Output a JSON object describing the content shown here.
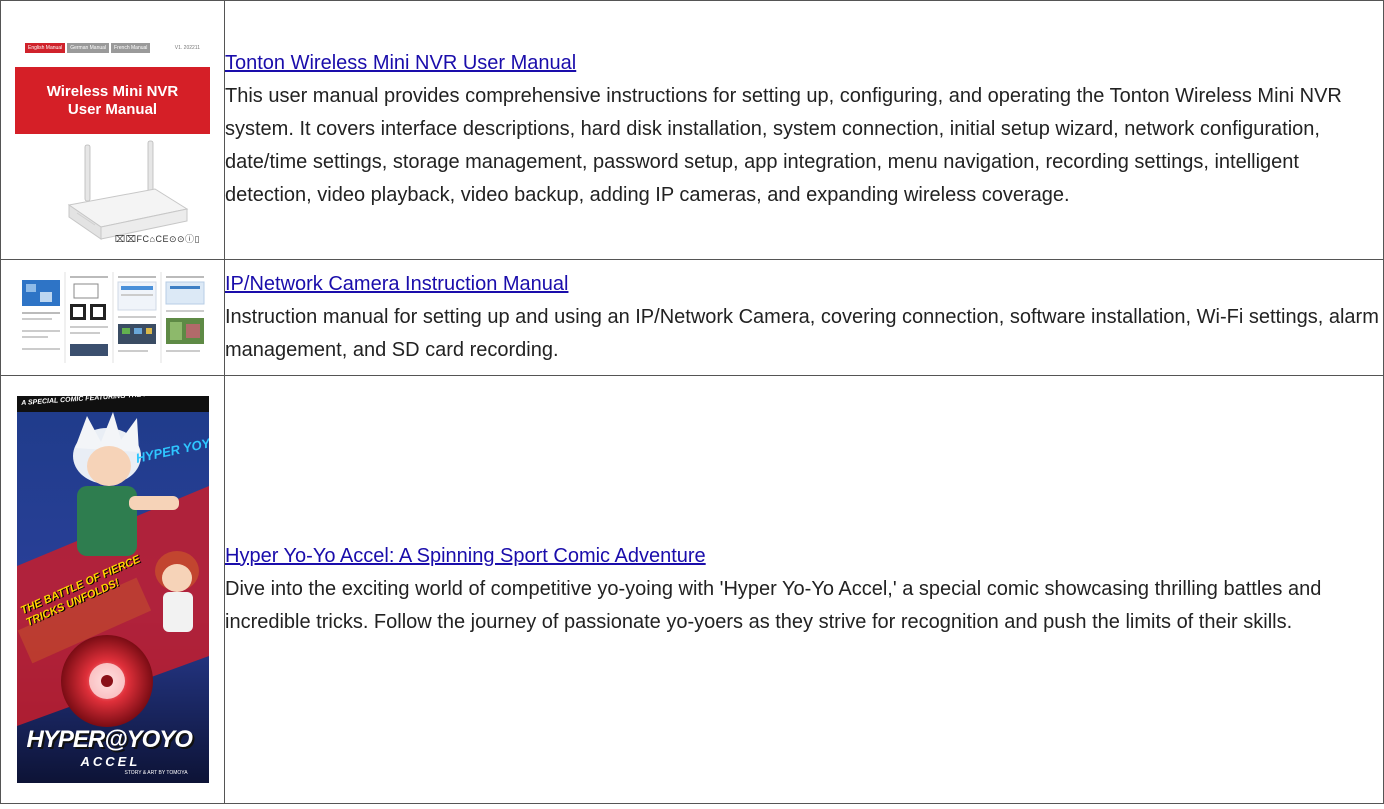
{
  "manuals": [
    {
      "title": "Tonton Wireless Mini NVR User Manual",
      "description": "This user manual provides comprehensive instructions for setting up, configuring, and operating the Tonton Wireless Mini NVR system. It covers interface descriptions, hard disk installation, system connection, initial setup wizard, network configuration, date/time settings, storage management, password setup, app integration, menu navigation, recording settings, intelligent detection, video playback, video backup, adding IP cameras, and expanding wireless coverage.",
      "thumbnail": {
        "tabs": [
          "English Manual",
          "German Manual",
          "French Manual"
        ],
        "version": "V1. 202211",
        "banner_line1": "Wireless Mini NVR",
        "banner_line2": "User Manual",
        "marks": "⌧⌧FC⌂CE⊙⊙ⓘ▯"
      }
    },
    {
      "title": "IP/Network Camera Instruction Manual",
      "description": "Instruction manual for setting up and using an IP/Network Camera, covering connection, software installation, Wi-Fi settings, alarm management, and SD card recording."
    },
    {
      "title": "Hyper Yo-Yo Accel: A Spinning Sport Comic Adventure",
      "description": "Dive into the exciting world of competitive yo-yoing with 'Hyper Yo-Yo Accel,' a special comic showcasing thrilling battles and incredible tricks. Follow the journey of passionate yo-yoers as they strive for recognition and push the limits of their skills.",
      "thumbnail": {
        "top_banner": "A SPECIAL COMIC FEATURING THE POPULAR SPINNING SPORT!",
        "side_text": "HYPER YOYO",
        "slogan_line1": "THE BATTLE OF FIERCE",
        "slogan_line2": "TRICKS UNFOLDS!",
        "logo_main": "HYPER@YOYO",
        "logo_sub": "ACCEL",
        "credit": "STORY & ART BY TOMOYA"
      }
    }
  ]
}
